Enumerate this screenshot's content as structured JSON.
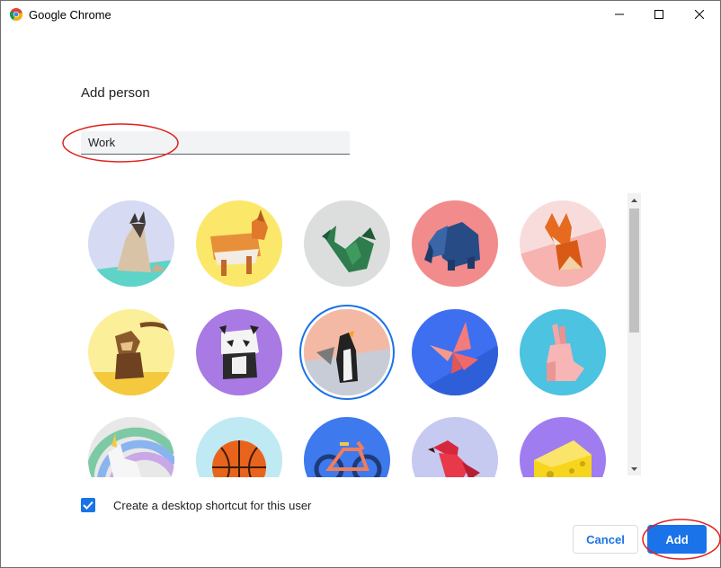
{
  "window": {
    "title": "Google Chrome",
    "controls": [
      "minimize-icon",
      "maximize-icon",
      "close-icon"
    ]
  },
  "dialog": {
    "heading": "Add person",
    "name_input": {
      "value": "Work",
      "placeholder": ""
    },
    "avatars": [
      {
        "name": "cat",
        "bg": "#d7d9f0"
      },
      {
        "name": "corgi",
        "bg": "#fbe86a"
      },
      {
        "name": "dragon",
        "bg": "#dadcdc"
      },
      {
        "name": "elephant",
        "bg": "#f28b8b"
      },
      {
        "name": "fox",
        "bg": "#fbd3d3"
      },
      {
        "name": "monkey",
        "bg": "#fcef9a"
      },
      {
        "name": "panda",
        "bg": "#a97ae3"
      },
      {
        "name": "penguin",
        "bg": "#f4b9a4",
        "selected": true
      },
      {
        "name": "butterfly",
        "bg": "#3d6ff0"
      },
      {
        "name": "rabbit",
        "bg": "#4cc3e0"
      },
      {
        "name": "unicorn",
        "bg": "#e8e8e8"
      },
      {
        "name": "basketball",
        "bg": "#bfe9f3"
      },
      {
        "name": "bicycle",
        "bg": "#3e79ee"
      },
      {
        "name": "bird",
        "bg": "#c6c9f0"
      },
      {
        "name": "cheese",
        "bg": "#9f7df0"
      }
    ],
    "shortcut_checkbox": {
      "checked": true,
      "label": "Create a desktop shortcut for this user"
    },
    "buttons": {
      "cancel": "Cancel",
      "add": "Add"
    }
  },
  "colors": {
    "accent": "#1a73e8",
    "annotation": "#e0201c"
  }
}
